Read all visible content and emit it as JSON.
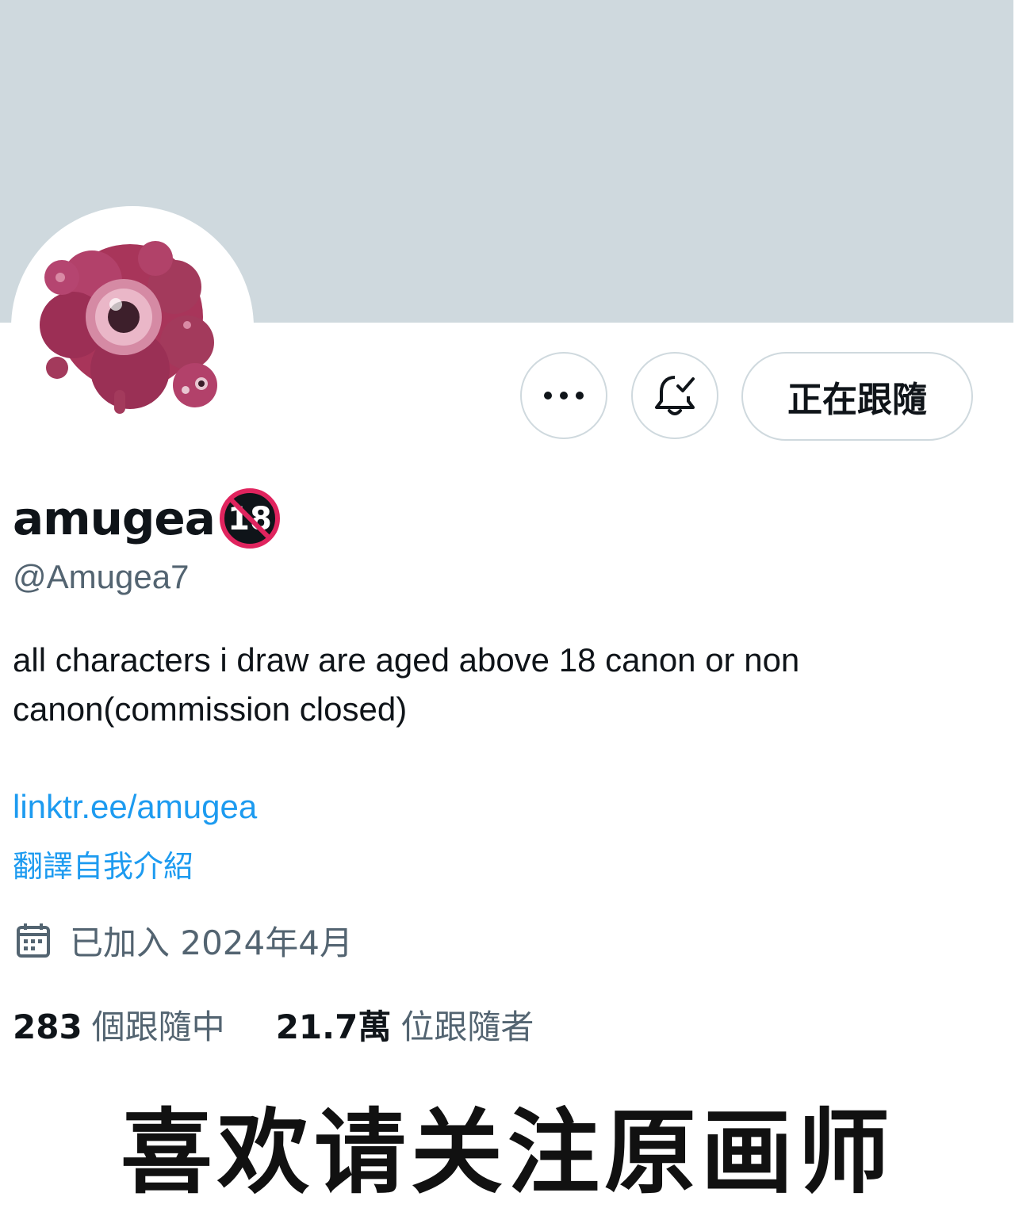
{
  "profile": {
    "display_name": "amugea",
    "handle": "@Amugea7",
    "badge_text": "18",
    "bio": "all characters i draw are aged above 18 canon or non canon(commission closed)",
    "link": "linktr.ee/amugea",
    "translate_label": "翻譯自我介紹",
    "joined": "已加入 2024年4月"
  },
  "actions": {
    "follow_label": "正在跟隨",
    "more_icon": "more-icon",
    "notify_icon": "bell-check-icon"
  },
  "stats": {
    "following_count": "283",
    "following_label": "個跟隨中",
    "followers_count": "21.7萬",
    "followers_label": "位跟隨者"
  },
  "caption": "喜欢请关注原画师",
  "colors": {
    "banner": "#cfd9de",
    "link": "#1d9bf0",
    "secondary_text": "#536471",
    "avatar_accent": "#a33a5c"
  }
}
